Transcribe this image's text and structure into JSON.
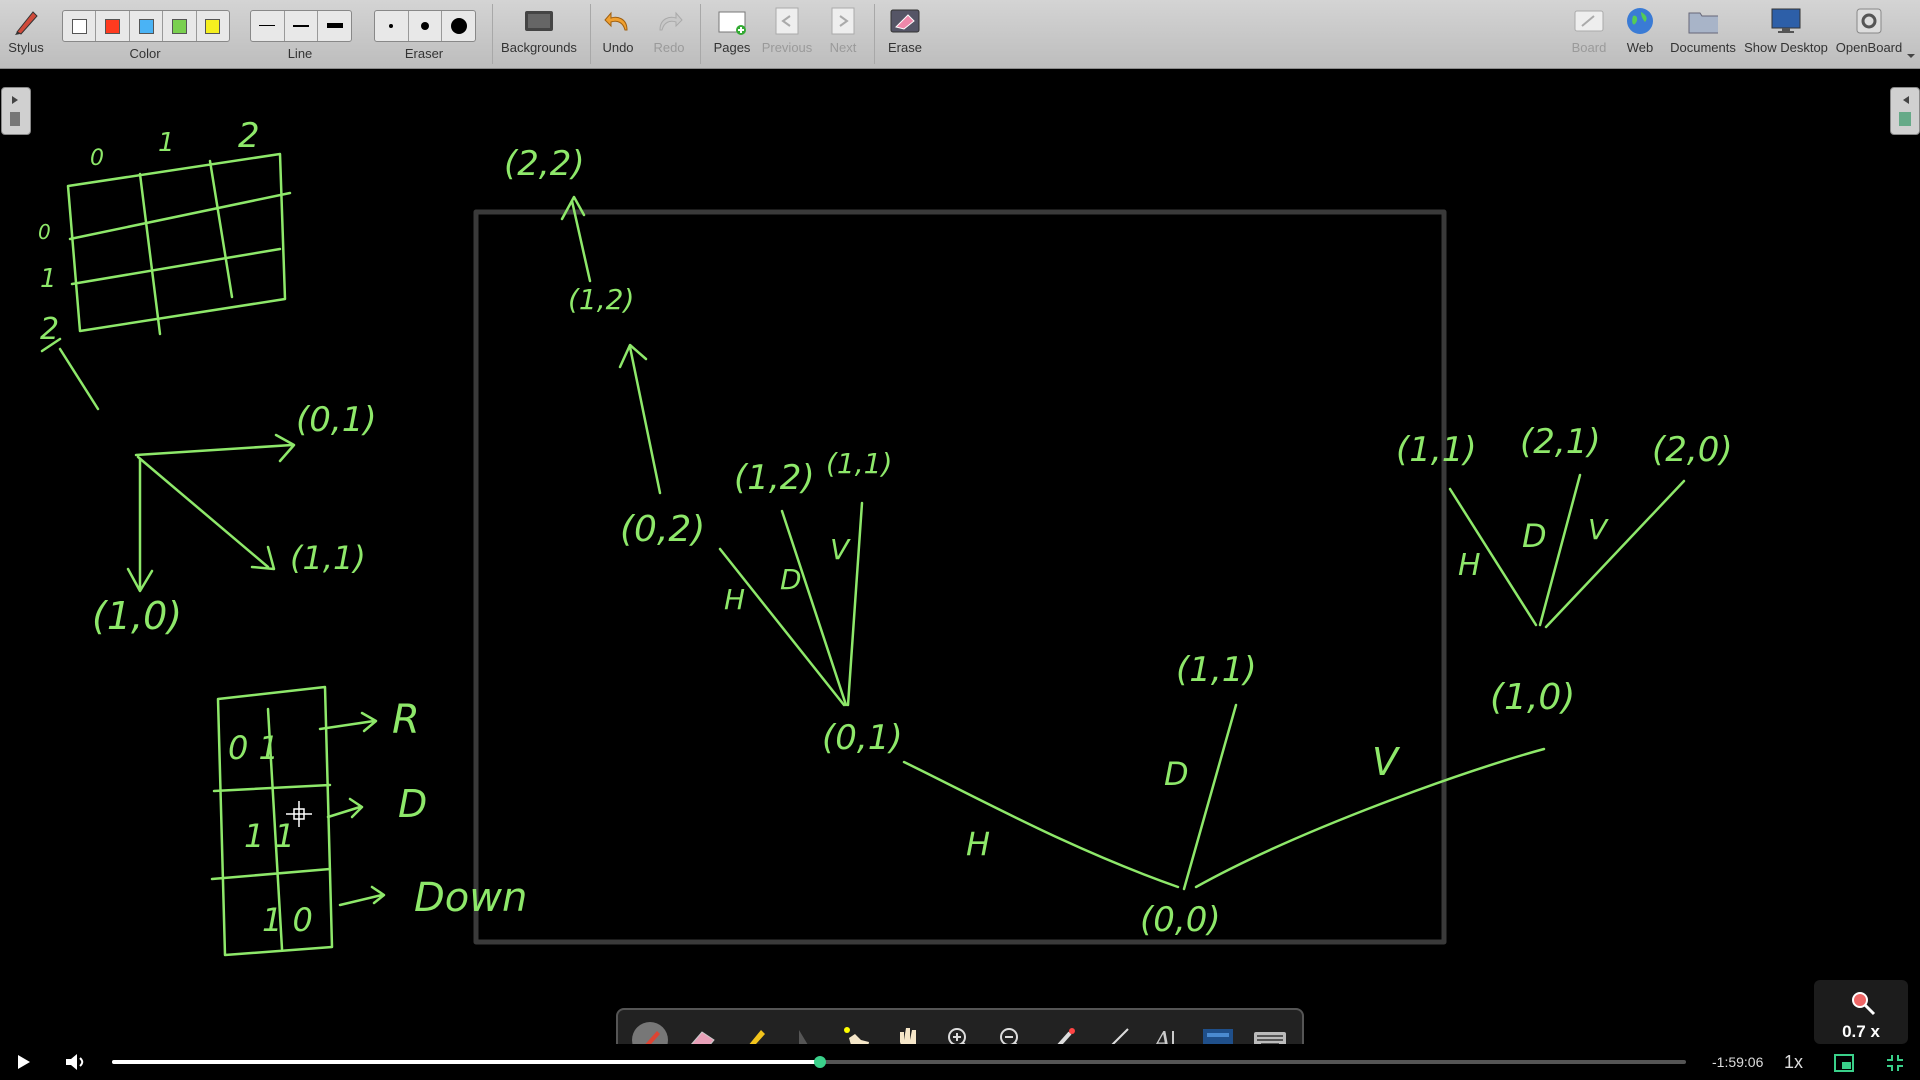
{
  "toolbar": {
    "stylus_label": "Stylus",
    "color_label": "Color",
    "colors": [
      "#ffffff",
      "#ff3b1f",
      "#4ab3f5",
      "#7ad04f",
      "#f5ef1f"
    ],
    "line_label": "Line",
    "eraser_label": "Eraser",
    "backgrounds_label": "Backgrounds",
    "undo_label": "Undo",
    "redo_label": "Redo",
    "pages_label": "Pages",
    "previous_label": "Previous",
    "next_label": "Next",
    "erase_label": "Erase",
    "board_label": "Board",
    "web_label": "Web",
    "documents_label": "Documents",
    "show_desktop_label": "Show Desktop",
    "openboard_label": "OpenBoard"
  },
  "board": {
    "ink_color": "#8ee86a",
    "grid_col_labels": [
      "0",
      "1",
      "2"
    ],
    "grid_row_labels": [
      "0",
      "1",
      "2"
    ],
    "notes": {
      "n01": "(0,1)",
      "n11": "(1,1)",
      "n10": "(1,0)",
      "t01": "0 1",
      "t11": "1 1",
      "t10": "1 0",
      "arrow_r": "R",
      "arrow_d": "D",
      "arrow_down": "Down"
    },
    "tree": {
      "root": "(0,0)",
      "edge_h": "H",
      "edge_d": "D",
      "edge_v": "V",
      "n01": "(0,1)",
      "n11a": "(1,1)",
      "n10": "(1,0)",
      "n02": "(0,2)",
      "n12a": "(1,2)",
      "n11b": "(1,1)",
      "n12b": "(1,2)",
      "n22": "(2,2)",
      "n11c": "(1,1)",
      "n21": "(2,1)",
      "n20": "(2,0)"
    }
  },
  "player": {
    "time_remaining": "-1:59:06",
    "speed": "1x",
    "zoom": "0.7 x",
    "progress": 0.45
  }
}
